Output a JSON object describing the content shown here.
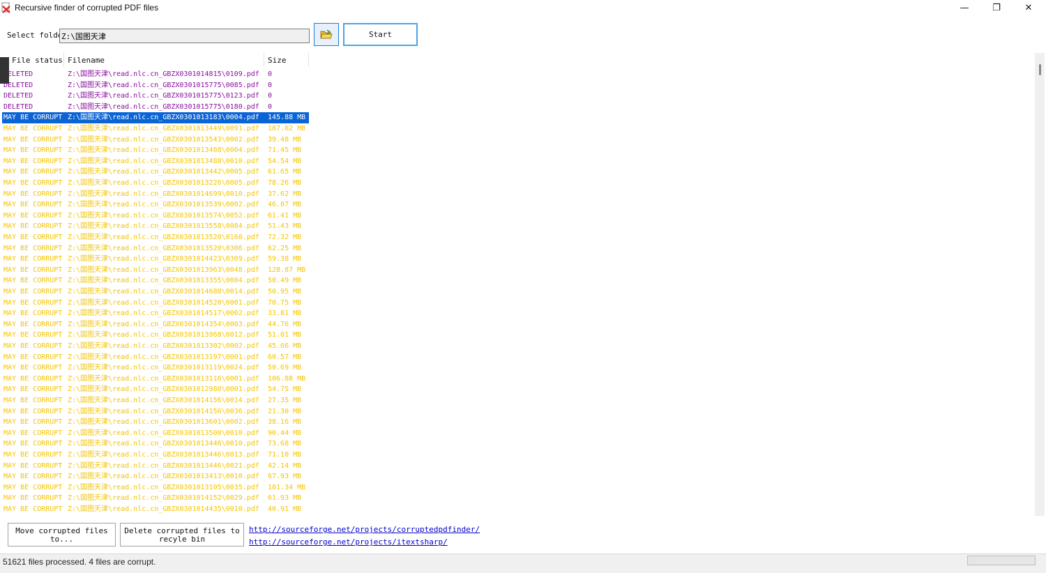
{
  "window": {
    "title": "Recursive finder of corrupted PDF files",
    "minimize": "—",
    "maximize": "❐",
    "close": "✕"
  },
  "folder": {
    "label": "Select folder",
    "value": "Z:\\国图天津"
  },
  "start_label": "Start",
  "columns": [
    "File status",
    "Filename",
    "Size"
  ],
  "rows": [
    {
      "status": "DELETED",
      "file": "Z:\\国图天津\\read.nlc.cn_GBZX0301014815\\0109.pdf",
      "size": "0",
      "kind": "deleted"
    },
    {
      "status": "DELETED",
      "file": "Z:\\国图天津\\read.nlc.cn_GBZX0301015775\\0085.pdf",
      "size": "0",
      "kind": "deleted"
    },
    {
      "status": "DELETED",
      "file": "Z:\\国图天津\\read.nlc.cn_GBZX0301015775\\0123.pdf",
      "size": "0",
      "kind": "deleted"
    },
    {
      "status": "DELETED",
      "file": "Z:\\国图天津\\read.nlc.cn_GBZX0301015775\\0180.pdf",
      "size": "0",
      "kind": "deleted"
    },
    {
      "status": "MAY BE CORRUPT",
      "file": "Z:\\国图天津\\read.nlc.cn_GBZX0301013183\\0004.pdf",
      "size": "145.88 MB",
      "kind": "selected"
    },
    {
      "status": "MAY BE CORRUPT",
      "file": "Z:\\国图天津\\read.nlc.cn_GBZX0301013449\\0091.pdf",
      "size": "107.02 MB",
      "kind": "corrupt"
    },
    {
      "status": "MAY BE CORRUPT",
      "file": "Z:\\国图天津\\read.nlc.cn_GBZX0301013543\\0002.pdf",
      "size": "39.48 MB",
      "kind": "corrupt"
    },
    {
      "status": "MAY BE CORRUPT",
      "file": "Z:\\国图天津\\read.nlc.cn_GBZX0301013488\\0004.pdf",
      "size": "71.45 MB",
      "kind": "corrupt"
    },
    {
      "status": "MAY BE CORRUPT",
      "file": "Z:\\国图天津\\read.nlc.cn_GBZX0301013488\\0010.pdf",
      "size": "54.54 MB",
      "kind": "corrupt"
    },
    {
      "status": "MAY BE CORRUPT",
      "file": "Z:\\国图天津\\read.nlc.cn_GBZX0301013442\\0005.pdf",
      "size": "61.65 MB",
      "kind": "corrupt"
    },
    {
      "status": "MAY BE CORRUPT",
      "file": "Z:\\国图天津\\read.nlc.cn_GBZX0301013226\\0005.pdf",
      "size": "78.26 MB",
      "kind": "corrupt"
    },
    {
      "status": "MAY BE CORRUPT",
      "file": "Z:\\国图天津\\read.nlc.cn_GBZX0301014699\\0010.pdf",
      "size": "37.62 MB",
      "kind": "corrupt"
    },
    {
      "status": "MAY BE CORRUPT",
      "file": "Z:\\国图天津\\read.nlc.cn_GBZX0301013539\\0002.pdf",
      "size": "46.07 MB",
      "kind": "corrupt"
    },
    {
      "status": "MAY BE CORRUPT",
      "file": "Z:\\国图天津\\read.nlc.cn_GBZX0301013574\\0052.pdf",
      "size": "61.41 MB",
      "kind": "corrupt"
    },
    {
      "status": "MAY BE CORRUPT",
      "file": "Z:\\国图天津\\read.nlc.cn_GBZX0301013558\\0084.pdf",
      "size": "51.43 MB",
      "kind": "corrupt"
    },
    {
      "status": "MAY BE CORRUPT",
      "file": "Z:\\国图天津\\read.nlc.cn_GBZX0301013520\\0160.pdf",
      "size": "72.32 MB",
      "kind": "corrupt"
    },
    {
      "status": "MAY BE CORRUPT",
      "file": "Z:\\国图天津\\read.nlc.cn_GBZX0301013520\\0306.pdf",
      "size": "62.25 MB",
      "kind": "corrupt"
    },
    {
      "status": "MAY BE CORRUPT",
      "file": "Z:\\国图天津\\read.nlc.cn_GBZX0301014423\\0309.pdf",
      "size": "59.38 MB",
      "kind": "corrupt"
    },
    {
      "status": "MAY BE CORRUPT",
      "file": "Z:\\国图天津\\read.nlc.cn_GBZX0301013963\\0048.pdf",
      "size": "128.87 MB",
      "kind": "corrupt"
    },
    {
      "status": "MAY BE CORRUPT",
      "file": "Z:\\国图天津\\read.nlc.cn_GBZX0301013355\\0004.pdf",
      "size": "50.49 MB",
      "kind": "corrupt"
    },
    {
      "status": "MAY BE CORRUPT",
      "file": "Z:\\国图天津\\read.nlc.cn_GBZX0301014688\\0014.pdf",
      "size": "50.95 MB",
      "kind": "corrupt"
    },
    {
      "status": "MAY BE CORRUPT",
      "file": "Z:\\国图天津\\read.nlc.cn_GBZX0301014520\\0001.pdf",
      "size": "70.75 MB",
      "kind": "corrupt"
    },
    {
      "status": "MAY BE CORRUPT",
      "file": "Z:\\国图天津\\read.nlc.cn_GBZX0301014517\\0002.pdf",
      "size": "33.81 MB",
      "kind": "corrupt"
    },
    {
      "status": "MAY BE CORRUPT",
      "file": "Z:\\国图天津\\read.nlc.cn_GBZX0301014354\\0003.pdf",
      "size": "44.76 MB",
      "kind": "corrupt"
    },
    {
      "status": "MAY BE CORRUPT",
      "file": "Z:\\国图天津\\read.nlc.cn_GBZX0301013968\\0012.pdf",
      "size": "51.01 MB",
      "kind": "corrupt"
    },
    {
      "status": "MAY BE CORRUPT",
      "file": "Z:\\国图天津\\read.nlc.cn_GBZX0301013302\\0002.pdf",
      "size": "45.66 MB",
      "kind": "corrupt"
    },
    {
      "status": "MAY BE CORRUPT",
      "file": "Z:\\国图天津\\read.nlc.cn_GBZX0301013197\\0001.pdf",
      "size": "60.57 MB",
      "kind": "corrupt"
    },
    {
      "status": "MAY BE CORRUPT",
      "file": "Z:\\国图天津\\read.nlc.cn_GBZX0301013119\\0024.pdf",
      "size": "50.69 MB",
      "kind": "corrupt"
    },
    {
      "status": "MAY BE CORRUPT",
      "file": "Z:\\国图天津\\read.nlc.cn_GBZX0301013116\\0001.pdf",
      "size": "106.88 MB",
      "kind": "corrupt"
    },
    {
      "status": "MAY BE CORRUPT",
      "file": "Z:\\国图天津\\read.nlc.cn_GBZX0301012980\\0001.pdf",
      "size": "54.75 MB",
      "kind": "corrupt"
    },
    {
      "status": "MAY BE CORRUPT",
      "file": "Z:\\国图天津\\read.nlc.cn_GBZX0301014156\\0014.pdf",
      "size": "27.35 MB",
      "kind": "corrupt"
    },
    {
      "status": "MAY BE CORRUPT",
      "file": "Z:\\国图天津\\read.nlc.cn_GBZX0301014156\\0036.pdf",
      "size": "21.30 MB",
      "kind": "corrupt"
    },
    {
      "status": "MAY BE CORRUPT",
      "file": "Z:\\国图天津\\read.nlc.cn_GBZX0301013601\\0002.pdf",
      "size": "38.16 MB",
      "kind": "corrupt"
    },
    {
      "status": "MAY BE CORRUPT",
      "file": "Z:\\国图天津\\read.nlc.cn_GBZX0301013500\\0010.pdf",
      "size": "90.44 MB",
      "kind": "corrupt"
    },
    {
      "status": "MAY BE CORRUPT",
      "file": "Z:\\国图天津\\read.nlc.cn_GBZX0301013446\\0010.pdf",
      "size": "73.68 MB",
      "kind": "corrupt"
    },
    {
      "status": "MAY BE CORRUPT",
      "file": "Z:\\国图天津\\read.nlc.cn_GBZX0301013446\\0013.pdf",
      "size": "71.10 MB",
      "kind": "corrupt"
    },
    {
      "status": "MAY BE CORRUPT",
      "file": "Z:\\国图天津\\read.nlc.cn_GBZX0301013446\\0021.pdf",
      "size": "42.14 MB",
      "kind": "corrupt"
    },
    {
      "status": "MAY BE CORRUPT",
      "file": "Z:\\国图天津\\read.nlc.cn_GBZX0301013413\\0010.pdf",
      "size": "67.93 MB",
      "kind": "corrupt"
    },
    {
      "status": "MAY BE CORRUPT",
      "file": "Z:\\国图天津\\read.nlc.cn_GBZX0301013105\\0035.pdf",
      "size": "101.34 MB",
      "kind": "corrupt"
    },
    {
      "status": "MAY BE CORRUPT",
      "file": "Z:\\国图天津\\read.nlc.cn_GBZX0301014152\\0029.pdf",
      "size": "61.93 MB",
      "kind": "corrupt"
    },
    {
      "status": "MAY BE CORRUPT",
      "file": "Z:\\国图天津\\read.nlc.cn_GBZX0301014435\\0010.pdf",
      "size": "40.91 MB",
      "kind": "corrupt"
    }
  ],
  "buttons": {
    "move": "Move corrupted files to...",
    "delete": "Delete corrupted files to recyle bin"
  },
  "links": [
    "http://sourceforge.net/projects/corruptedpdfinder/",
    "http://sourceforge.net/projects/itextsharp/"
  ],
  "status": "51621 files processed. 4 files are corrupt.",
  "progress": 0,
  "colors": {
    "deleted": "#8a0f9e",
    "corrupt": "#f5c400",
    "selection": "#0a64d6",
    "link": "#0000cc"
  },
  "icons": {
    "app": "pdf-error-icon",
    "browse": "folder-open-icon"
  }
}
